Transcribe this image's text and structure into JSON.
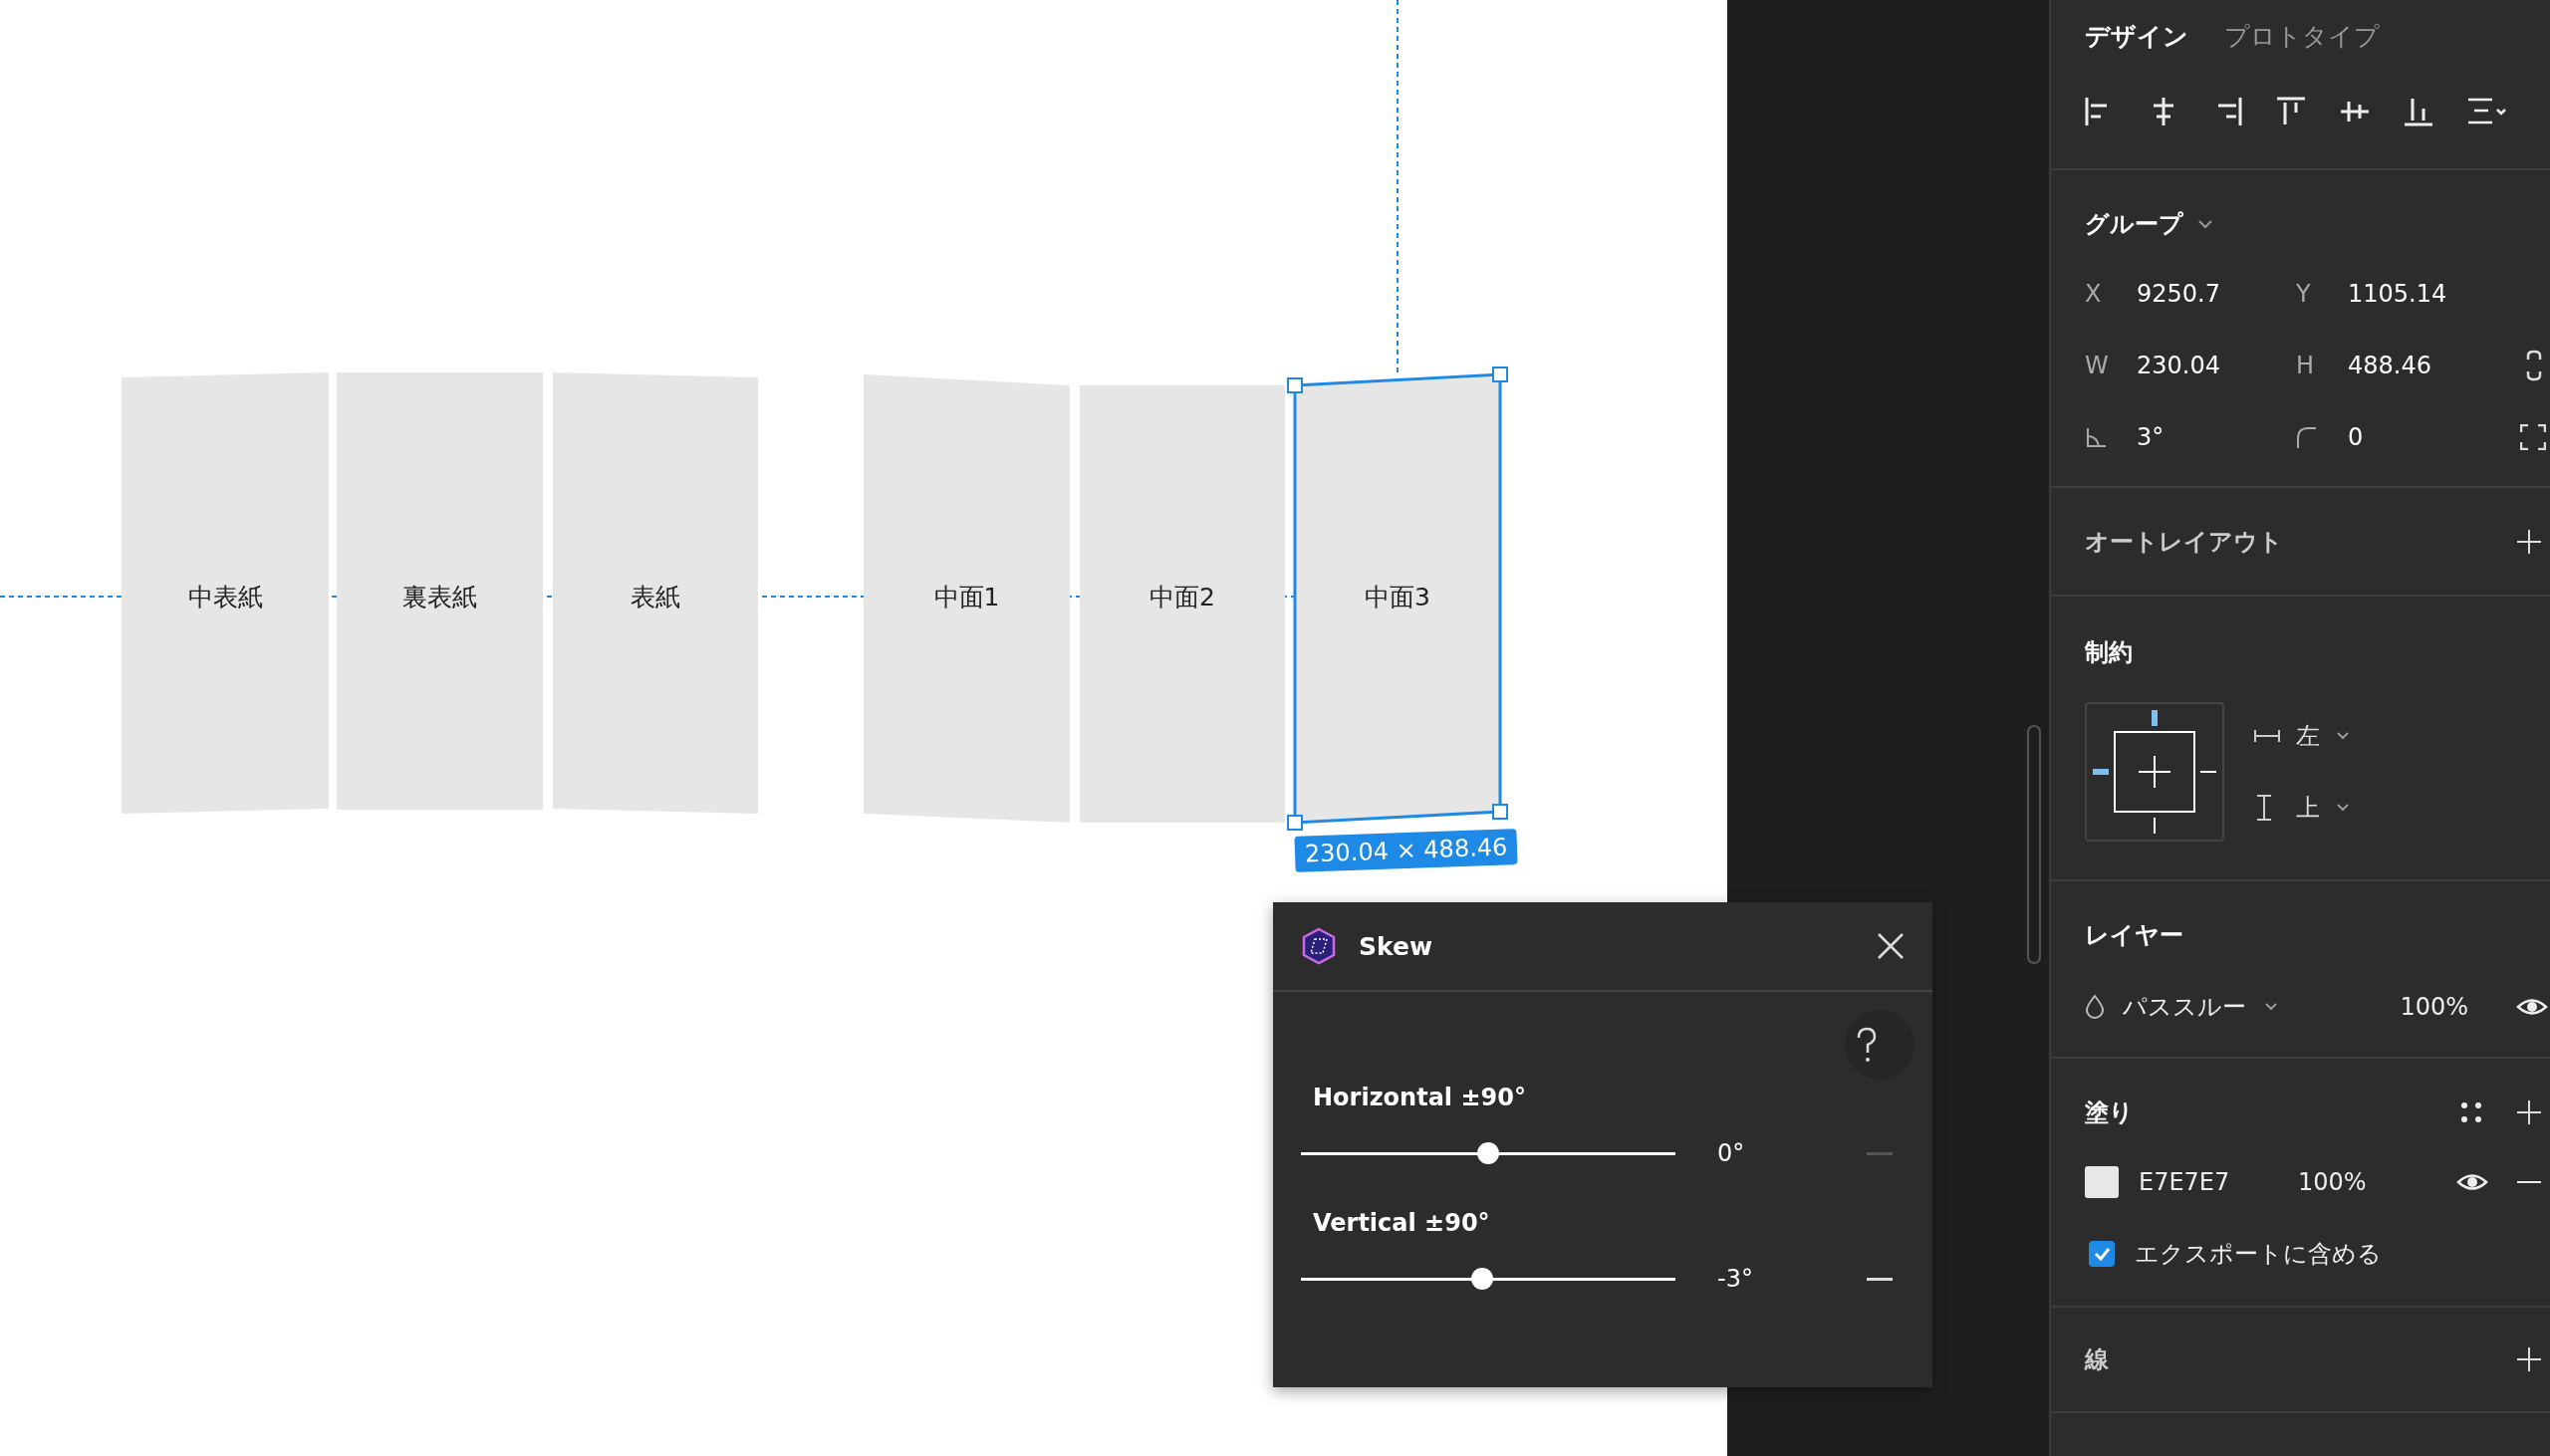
{
  "canvas": {
    "pages": [
      {
        "label": "中表紙",
        "selected": false
      },
      {
        "label": "裏表紙",
        "selected": false
      },
      {
        "label": "表紙",
        "selected": false
      },
      {
        "label": "中面1",
        "selected": false
      },
      {
        "label": "中面2",
        "selected": false
      },
      {
        "label": "中面3",
        "selected": true
      }
    ],
    "selection_size": "230.04 × 488.46"
  },
  "skew_dialog": {
    "title": "Skew",
    "sliders": [
      {
        "label": "Horizontal ±90°",
        "level": 0.5,
        "reading": "0°",
        "reset_enabled": false
      },
      {
        "label": "Vertical ±90°",
        "level": 0.485,
        "reading": "-3°",
        "reset_enabled": true
      }
    ]
  },
  "tabs": [
    {
      "label": "デザイン",
      "selected": true
    },
    {
      "label": "プロトタイプ",
      "selected": false
    }
  ],
  "group": {
    "title": "グループ",
    "rows": [
      [
        {
          "kind": "letter",
          "label": "X",
          "value": "9250.7"
        },
        {
          "kind": "letter",
          "label": "Y",
          "value": "1105.14"
        }
      ],
      [
        {
          "kind": "letter",
          "label": "W",
          "value": "230.04"
        },
        {
          "kind": "letter",
          "label": "H",
          "value": "488.46"
        }
      ],
      [
        {
          "kind": "rotation",
          "value": "3°"
        },
        {
          "kind": "radius",
          "value": "0"
        }
      ]
    ]
  },
  "auto_layout": {
    "title": "オートレイアウト"
  },
  "constraints": {
    "title": "制約",
    "horizontal": "左",
    "vertical": "上"
  },
  "layer": {
    "title": "レイヤー",
    "blend": "パススルー",
    "opacity": "100%"
  },
  "fill": {
    "title": "塗り",
    "items": [
      {
        "hex": "E7E7E7",
        "color": "#e7e7e7",
        "opacity": "100%"
      }
    ],
    "export": {
      "label": "エクスポートに含める",
      "checked": true
    }
  },
  "stroke": {
    "title": "線"
  }
}
